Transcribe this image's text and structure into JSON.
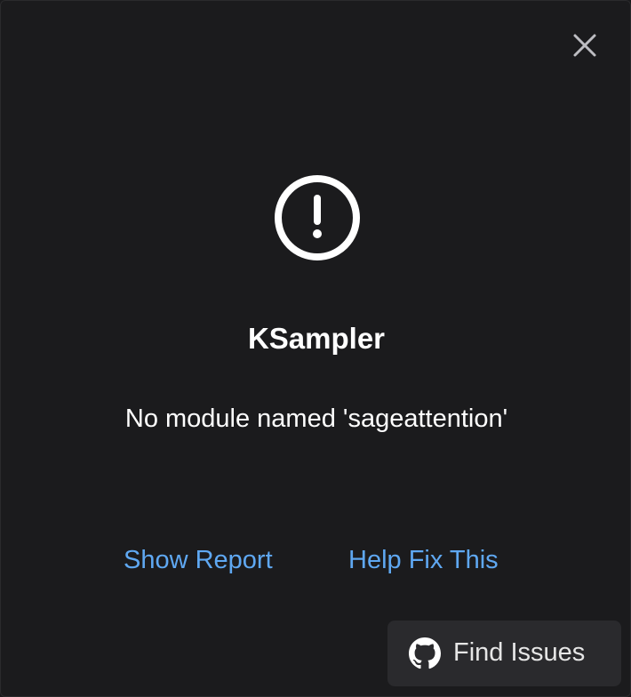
{
  "dialog": {
    "title": "KSampler",
    "message": "No module named 'sageattention'",
    "links": {
      "show_report": "Show Report",
      "help_fix": "Help Fix This"
    },
    "find_issues_label": "Find Issues",
    "icons": {
      "close": "close-icon",
      "warning": "exclamation-circle-icon",
      "github": "github-icon"
    },
    "colors": {
      "background": "#1b1b1d",
      "link": "#5fa8f2",
      "button_bg": "#2a2a2d",
      "text": "#ffffff"
    }
  }
}
